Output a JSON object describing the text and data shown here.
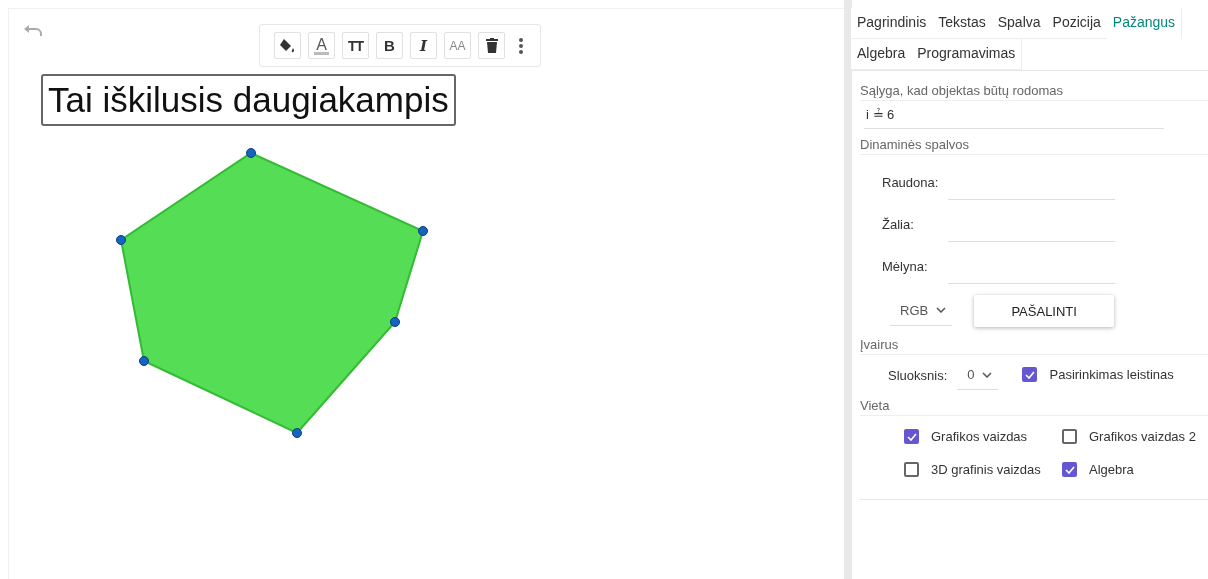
{
  "toolbar": [
    {
      "kind": "fill"
    },
    {
      "kind": "text-color",
      "label": "A"
    },
    {
      "kind": "text-size",
      "label": "TT"
    },
    {
      "kind": "bold",
      "label": "B"
    },
    {
      "kind": "italic",
      "label": "I"
    },
    {
      "kind": "font-size",
      "label": "AA"
    },
    {
      "kind": "delete"
    },
    {
      "kind": "more"
    }
  ],
  "text_label": "Tai iškilusis daugiakampis",
  "tabs": [
    {
      "label": "Pagrindinis",
      "selected": false
    },
    {
      "label": "Tekstas",
      "selected": false
    },
    {
      "label": "Spalva",
      "selected": false
    },
    {
      "label": "Pozicija",
      "selected": false
    },
    {
      "label": "Pažangus",
      "selected": true
    },
    {
      "label": "Algebra",
      "selected": false
    },
    {
      "label": "Programavimas",
      "selected": false
    }
  ],
  "condition": {
    "label": "Sąlyga, kad objektas būtų rodomas",
    "value": "i ≟ 6"
  },
  "dynamic_colors": {
    "title": "Dinaminės spalvos",
    "fields": [
      {
        "label": "Raudona:"
      },
      {
        "label": "Žalia:"
      },
      {
        "label": "Mėlyna:"
      }
    ],
    "mode": "RGB",
    "remove_button": "PAŠALINTI"
  },
  "misc": {
    "title": "Įvairus",
    "layer_label": "Sluoksnis:",
    "layer_value": "0",
    "selection_allowed": {
      "label": "Pasirinkimas leistinas",
      "checked": true
    }
  },
  "location": {
    "title": "Vieta",
    "options": [
      {
        "label": "Grafikos vaizdas",
        "checked": true
      },
      {
        "label": "Grafikos vaizdas 2",
        "checked": false
      },
      {
        "label": "3D grafinis vaizdas",
        "checked": false
      },
      {
        "label": "Algebra",
        "checked": true
      }
    ]
  }
}
